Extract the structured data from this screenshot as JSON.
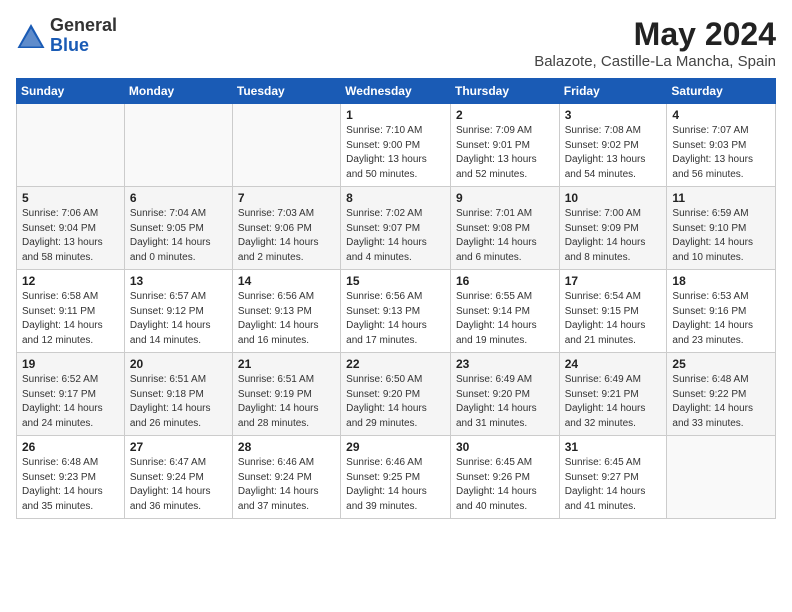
{
  "logo": {
    "general": "General",
    "blue": "Blue"
  },
  "title": "May 2024",
  "location": "Balazote, Castille-La Mancha, Spain",
  "weekdays": [
    "Sunday",
    "Monday",
    "Tuesday",
    "Wednesday",
    "Thursday",
    "Friday",
    "Saturday"
  ],
  "weeks": [
    [
      {
        "day": "",
        "detail": ""
      },
      {
        "day": "",
        "detail": ""
      },
      {
        "day": "",
        "detail": ""
      },
      {
        "day": "1",
        "detail": "Sunrise: 7:10 AM\nSunset: 9:00 PM\nDaylight: 13 hours\nand 50 minutes."
      },
      {
        "day": "2",
        "detail": "Sunrise: 7:09 AM\nSunset: 9:01 PM\nDaylight: 13 hours\nand 52 minutes."
      },
      {
        "day": "3",
        "detail": "Sunrise: 7:08 AM\nSunset: 9:02 PM\nDaylight: 13 hours\nand 54 minutes."
      },
      {
        "day": "4",
        "detail": "Sunrise: 7:07 AM\nSunset: 9:03 PM\nDaylight: 13 hours\nand 56 minutes."
      }
    ],
    [
      {
        "day": "5",
        "detail": "Sunrise: 7:06 AM\nSunset: 9:04 PM\nDaylight: 13 hours\nand 58 minutes."
      },
      {
        "day": "6",
        "detail": "Sunrise: 7:04 AM\nSunset: 9:05 PM\nDaylight: 14 hours\nand 0 minutes."
      },
      {
        "day": "7",
        "detail": "Sunrise: 7:03 AM\nSunset: 9:06 PM\nDaylight: 14 hours\nand 2 minutes."
      },
      {
        "day": "8",
        "detail": "Sunrise: 7:02 AM\nSunset: 9:07 PM\nDaylight: 14 hours\nand 4 minutes."
      },
      {
        "day": "9",
        "detail": "Sunrise: 7:01 AM\nSunset: 9:08 PM\nDaylight: 14 hours\nand 6 minutes."
      },
      {
        "day": "10",
        "detail": "Sunrise: 7:00 AM\nSunset: 9:09 PM\nDaylight: 14 hours\nand 8 minutes."
      },
      {
        "day": "11",
        "detail": "Sunrise: 6:59 AM\nSunset: 9:10 PM\nDaylight: 14 hours\nand 10 minutes."
      }
    ],
    [
      {
        "day": "12",
        "detail": "Sunrise: 6:58 AM\nSunset: 9:11 PM\nDaylight: 14 hours\nand 12 minutes."
      },
      {
        "day": "13",
        "detail": "Sunrise: 6:57 AM\nSunset: 9:12 PM\nDaylight: 14 hours\nand 14 minutes."
      },
      {
        "day": "14",
        "detail": "Sunrise: 6:56 AM\nSunset: 9:13 PM\nDaylight: 14 hours\nand 16 minutes."
      },
      {
        "day": "15",
        "detail": "Sunrise: 6:56 AM\nSunset: 9:13 PM\nDaylight: 14 hours\nand 17 minutes."
      },
      {
        "day": "16",
        "detail": "Sunrise: 6:55 AM\nSunset: 9:14 PM\nDaylight: 14 hours\nand 19 minutes."
      },
      {
        "day": "17",
        "detail": "Sunrise: 6:54 AM\nSunset: 9:15 PM\nDaylight: 14 hours\nand 21 minutes."
      },
      {
        "day": "18",
        "detail": "Sunrise: 6:53 AM\nSunset: 9:16 PM\nDaylight: 14 hours\nand 23 minutes."
      }
    ],
    [
      {
        "day": "19",
        "detail": "Sunrise: 6:52 AM\nSunset: 9:17 PM\nDaylight: 14 hours\nand 24 minutes."
      },
      {
        "day": "20",
        "detail": "Sunrise: 6:51 AM\nSunset: 9:18 PM\nDaylight: 14 hours\nand 26 minutes."
      },
      {
        "day": "21",
        "detail": "Sunrise: 6:51 AM\nSunset: 9:19 PM\nDaylight: 14 hours\nand 28 minutes."
      },
      {
        "day": "22",
        "detail": "Sunrise: 6:50 AM\nSunset: 9:20 PM\nDaylight: 14 hours\nand 29 minutes."
      },
      {
        "day": "23",
        "detail": "Sunrise: 6:49 AM\nSunset: 9:20 PM\nDaylight: 14 hours\nand 31 minutes."
      },
      {
        "day": "24",
        "detail": "Sunrise: 6:49 AM\nSunset: 9:21 PM\nDaylight: 14 hours\nand 32 minutes."
      },
      {
        "day": "25",
        "detail": "Sunrise: 6:48 AM\nSunset: 9:22 PM\nDaylight: 14 hours\nand 33 minutes."
      }
    ],
    [
      {
        "day": "26",
        "detail": "Sunrise: 6:48 AM\nSunset: 9:23 PM\nDaylight: 14 hours\nand 35 minutes."
      },
      {
        "day": "27",
        "detail": "Sunrise: 6:47 AM\nSunset: 9:24 PM\nDaylight: 14 hours\nand 36 minutes."
      },
      {
        "day": "28",
        "detail": "Sunrise: 6:46 AM\nSunset: 9:24 PM\nDaylight: 14 hours\nand 37 minutes."
      },
      {
        "day": "29",
        "detail": "Sunrise: 6:46 AM\nSunset: 9:25 PM\nDaylight: 14 hours\nand 39 minutes."
      },
      {
        "day": "30",
        "detail": "Sunrise: 6:45 AM\nSunset: 9:26 PM\nDaylight: 14 hours\nand 40 minutes."
      },
      {
        "day": "31",
        "detail": "Sunrise: 6:45 AM\nSunset: 9:27 PM\nDaylight: 14 hours\nand 41 minutes."
      },
      {
        "day": "",
        "detail": ""
      }
    ]
  ]
}
